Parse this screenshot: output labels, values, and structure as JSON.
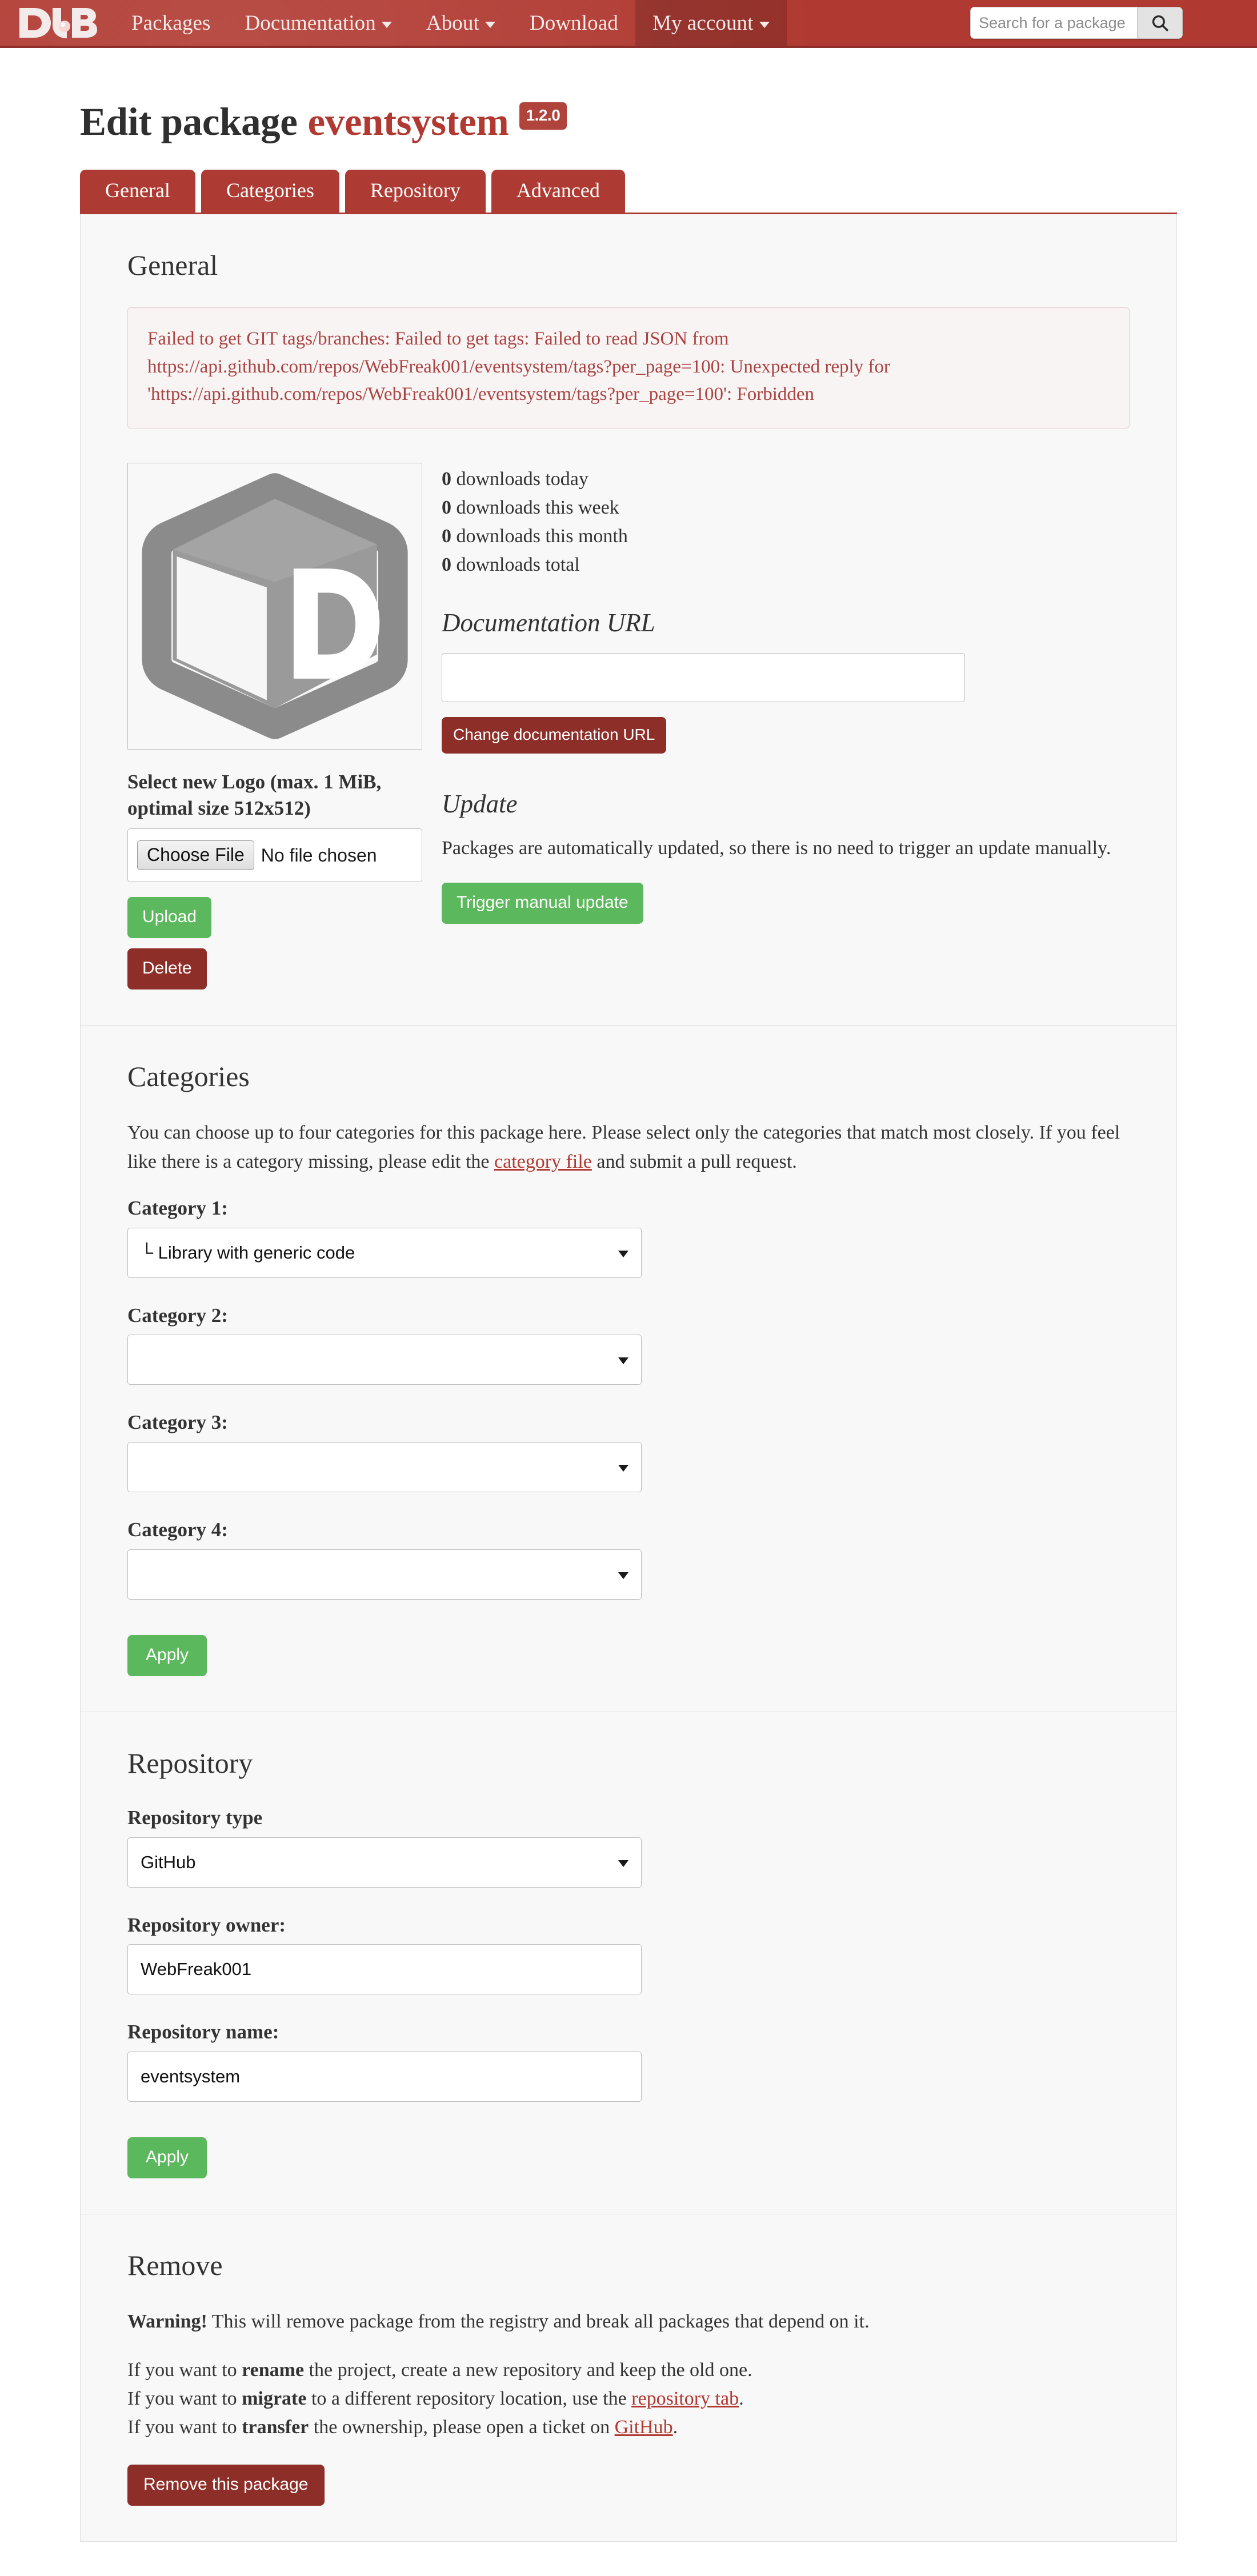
{
  "nav": {
    "logo_alt": "DUB",
    "items": [
      {
        "label": "Packages",
        "has_caret": false,
        "active": false
      },
      {
        "label": "Documentation",
        "has_caret": true,
        "active": false
      },
      {
        "label": "About",
        "has_caret": true,
        "active": false
      },
      {
        "label": "Download",
        "has_caret": false,
        "active": false
      },
      {
        "label": "My account",
        "has_caret": true,
        "active": true
      }
    ],
    "search": {
      "placeholder": "Search for a package",
      "value": "",
      "icon": "search-icon"
    }
  },
  "header": {
    "title_prefix": "Edit package",
    "package_name": "eventsystem",
    "version": "1.2.0"
  },
  "tabs": [
    {
      "label": "General",
      "active": true
    },
    {
      "label": "Categories",
      "active": false
    },
    {
      "label": "Repository",
      "active": false
    },
    {
      "label": "Advanced",
      "active": false
    }
  ],
  "general": {
    "heading": "General",
    "error": {
      "line1": "Failed to get GIT tags/branches: Failed to get tags: Failed to read JSON from",
      "line2": "https://api.github.com/repos/WebFreak001/eventsystem/tags?per_page=100: Unexpected reply for",
      "line3": "'https://api.github.com/repos/WebFreak001/eventsystem/tags?per_page=100': Forbidden"
    },
    "logo": {
      "icon": "package-cube-d-logo"
    },
    "logo_upload_label": "Select new Logo (max. 1 MiB, optimal size 512x512)",
    "file_input": {
      "button_label": "Choose File",
      "status": "No file chosen"
    },
    "upload_label": "Upload",
    "delete_label": "Delete",
    "stats": [
      {
        "count": "0",
        "text": "downloads today"
      },
      {
        "count": "0",
        "text": "downloads this week"
      },
      {
        "count": "0",
        "text": "downloads this month"
      },
      {
        "count": "0",
        "text": "downloads total"
      }
    ],
    "documentation": {
      "heading": "Documentation URL",
      "value": "",
      "placeholder": "",
      "button_label": "Change documentation URL"
    },
    "update": {
      "heading": "Update",
      "description": "Packages are automatically updated, so there is no need to trigger an update manually.",
      "button_label": "Trigger manual update"
    }
  },
  "categories": {
    "heading": "Categories",
    "description_part1": "You can choose up to four categories for this package here. Please select only the categories that match most closely. If you feel like there is a category missing, please edit the ",
    "description_link": "category file",
    "description_part2": " and submit a pull request.",
    "fields": [
      {
        "label": "Category 1:",
        "value": "└ Library with generic code"
      },
      {
        "label": "Category 2:",
        "value": ""
      },
      {
        "label": "Category 3:",
        "value": ""
      },
      {
        "label": "Category 4:",
        "value": ""
      }
    ],
    "apply_label": "Apply"
  },
  "repository": {
    "heading": "Repository",
    "type_label": "Repository type",
    "type_value": "GitHub",
    "owner_label": "Repository owner:",
    "owner_value": "WebFreak001",
    "name_label": "Repository name:",
    "name_value": "eventsystem",
    "apply_label": "Apply"
  },
  "remove": {
    "heading": "Remove",
    "warning_bold": "Warning!",
    "warning_rest": " This will remove package from the registry and break all packages that depend on it.",
    "line1_a": "If you want to ",
    "line1_bold": "rename",
    "line1_b": " the project, create a new repository and keep the old one.",
    "line2_a": "If you want to ",
    "line2_bold": "migrate",
    "line2_b": " to a different repository location, use the ",
    "line2_link": "repository tab",
    "line2_c": ".",
    "line3_a": "If you want to ",
    "line3_bold": "transfer",
    "line3_b": " the ownership, please open a ticket on ",
    "line3_link": "GitHub",
    "line3_c": ".",
    "button_label": "Remove this package"
  },
  "colors": {
    "brand_red": "#b03a32",
    "tab_red": "#ae3b33",
    "dark_red": "#8d2f28",
    "green": "#5cb85c",
    "alert_text": "#a94442",
    "alert_border": "#ebccd1",
    "card_bg": "#f8f8f8"
  }
}
